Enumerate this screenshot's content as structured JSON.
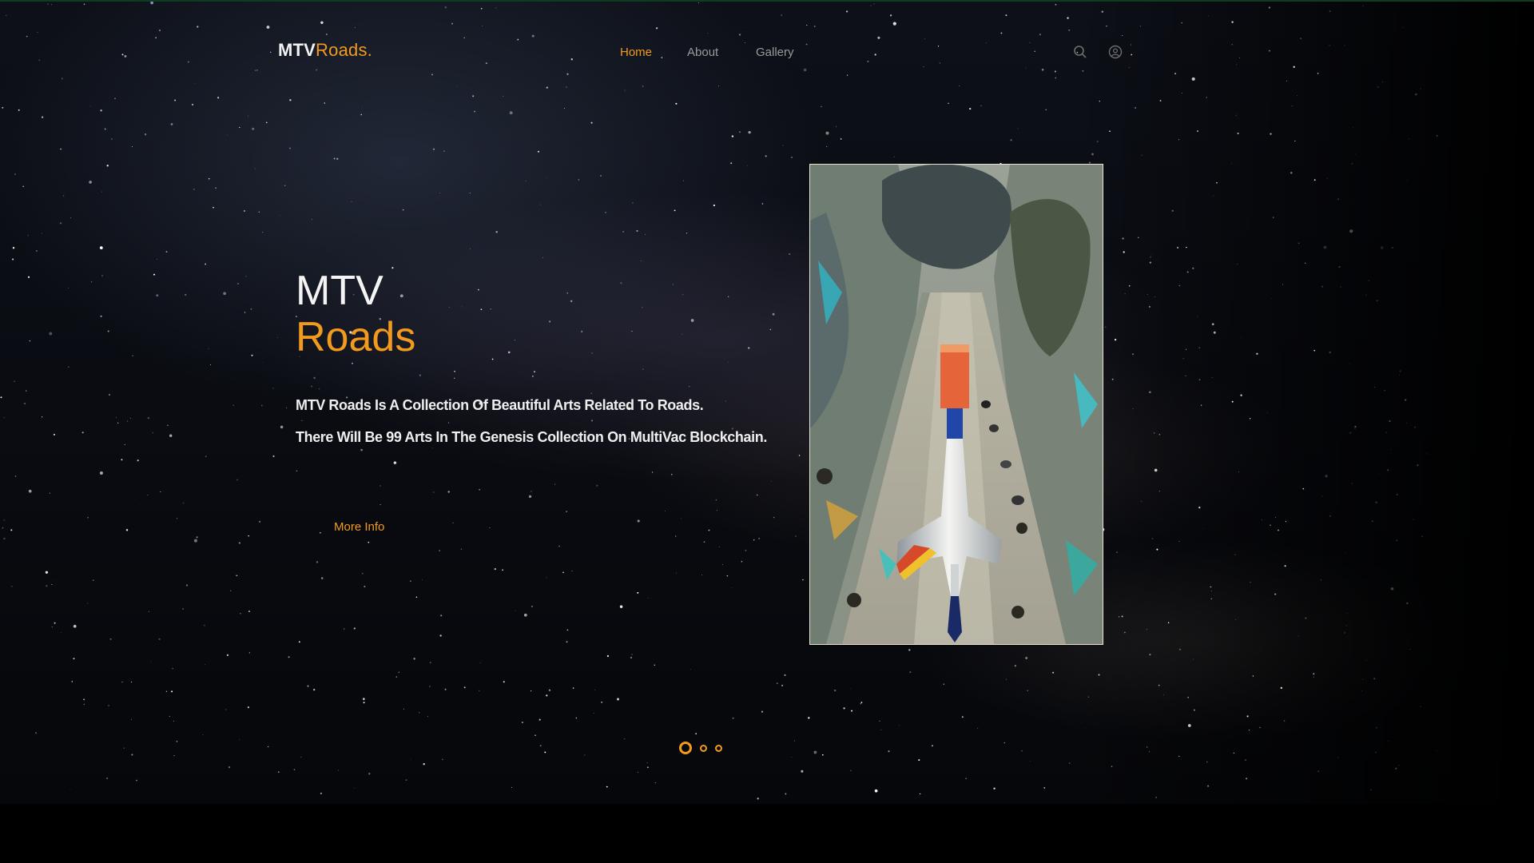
{
  "brand": {
    "part1": "MTV",
    "part2": "Roads",
    "dot": "."
  },
  "nav": {
    "items": [
      {
        "label": "Home",
        "active": true
      },
      {
        "label": "About",
        "active": false
      },
      {
        "label": "Gallery",
        "active": false
      }
    ]
  },
  "header_icons": [
    "search-icon",
    "user-icon"
  ],
  "hero": {
    "title_line1": "MTV",
    "title_line2": "Roads",
    "description_line1": "MTV Roads Is A Collection Of Beautiful Arts Related To Roads.",
    "description_line2": "There Will Be 99 Arts In The Genesis Collection On MultiVac Blockchain.",
    "button_label": "More Info"
  },
  "artwork": {
    "subject": "stylized painting of a space shuttle on a road"
  },
  "slider": {
    "count": 3,
    "active_index": 0
  },
  "colors": {
    "accent": "#f29a1e",
    "text": "#f4f4f4",
    "nav_inactive": "#9a9a9a",
    "background": "#000000"
  }
}
